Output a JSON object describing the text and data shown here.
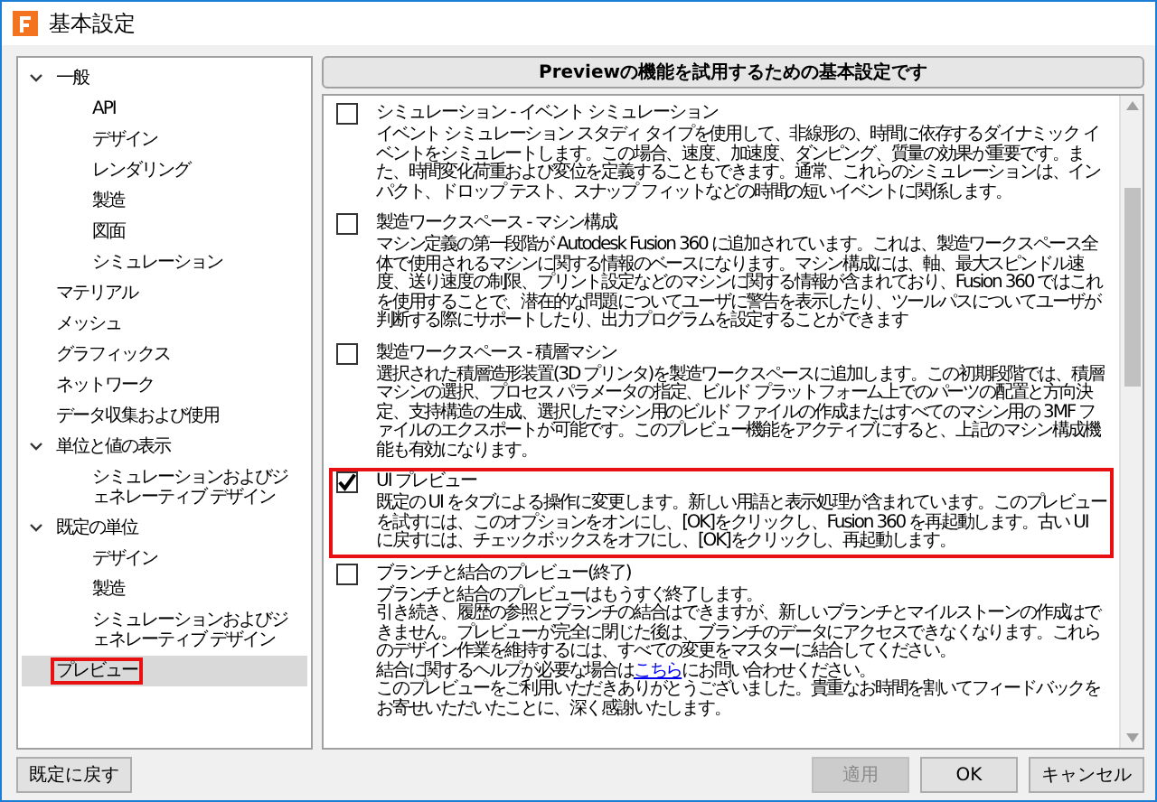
{
  "window": {
    "title": "基本設定"
  },
  "tree": [
    {
      "label": "一般",
      "expanded": true,
      "selected": false,
      "highlighted": false,
      "children": [
        {
          "label": "API",
          "selected": false,
          "highlighted": false
        },
        {
          "label": "デザイン",
          "selected": false,
          "highlighted": false
        },
        {
          "label": "レンダリング",
          "selected": false,
          "highlighted": false
        },
        {
          "label": "製造",
          "selected": false,
          "highlighted": false
        },
        {
          "label": "図面",
          "selected": false,
          "highlighted": false
        },
        {
          "label": "シミュレーション",
          "selected": false,
          "highlighted": false
        }
      ]
    },
    {
      "label": "マテリアル",
      "selected": false,
      "highlighted": false
    },
    {
      "label": "メッシュ",
      "selected": false,
      "highlighted": false
    },
    {
      "label": "グラフィックス",
      "selected": false,
      "highlighted": false
    },
    {
      "label": "ネットワーク",
      "selected": false,
      "highlighted": false
    },
    {
      "label": "データ収集および使用",
      "selected": false,
      "highlighted": false
    },
    {
      "label": "単位と値の表示",
      "expanded": true,
      "selected": false,
      "highlighted": false,
      "children": [
        {
          "label": "シミュレーションおよびジェネレーティブ デザイン",
          "selected": false,
          "highlighted": false
        }
      ]
    },
    {
      "label": "既定の単位",
      "expanded": true,
      "selected": false,
      "highlighted": false,
      "children": [
        {
          "label": "デザイン",
          "selected": false,
          "highlighted": false
        },
        {
          "label": "製造",
          "selected": false,
          "highlighted": false
        },
        {
          "label": "シミュレーションおよびジェネレーティブ デザイン",
          "selected": false,
          "highlighted": false
        }
      ]
    },
    {
      "label": "プレビュー",
      "selected": true,
      "highlighted": true
    }
  ],
  "reset_button": "既定に戻す",
  "header": "Previewの機能を試用するための基本設定です",
  "features": [
    {
      "title": "シミュレーション - イベント シミュレーション",
      "checked": false,
      "highlighted": false,
      "lines": [
        [
          {
            "text": "イベント シミュレーション スタディ タイプを使用して、非線形の、時間に依存するダイナミック イベントをシミュレートします。この場合、速度、加速度、ダンピング、質量の効果が重要です。また、時間変化荷重および変位を定義することもできます。通常、これらのシミュレーションは、インパクト、ドロップ テスト、スナップ フィットなどの時間の短いイベントに関係します。"
          }
        ]
      ]
    },
    {
      "title": "製造ワークスペース - マシン構成",
      "checked": false,
      "highlighted": false,
      "lines": [
        [
          {
            "text": "マシン定義の第一段階が Autodesk Fusion 360 に追加されています。これは、製造ワークスペース全体で使用されるマシンに関する情報のベースになります。マシン構成には、軸、最大スピンドル速度、送り速度の制限、プリント設定などのマシンに関する情報が含まれており、Fusion 360 ではこれを使用することで、潜在的な問題についてユーザに警告を表示したり、ツールパスについてユーザが判断する際にサポートしたり、出力プログラムを設定することができます"
          }
        ]
      ]
    },
    {
      "title": "製造ワークスペース - 積層マシン",
      "checked": false,
      "highlighted": false,
      "lines": [
        [
          {
            "text": "選択された積層造形装置(3D プリンタ)を製造ワークスペースに追加します。この初期段階では、積層マシンの選択、プロセス パラメータの指定、ビルド プラットフォーム上でのパーツの配置と方向決定、支持構造の生成、選択したマシン用のビルド ファイルの作成またはすべてのマシン用の 3MF ファイルのエクスポートが可能です。このプレビュー機能をアクティブにすると、上記のマシン構成機能も有効になります。"
          }
        ]
      ]
    },
    {
      "title": "UI プレビュー",
      "checked": true,
      "highlighted": true,
      "lines": [
        [
          {
            "text": "既定の UI をタブによる操作に変更します。新しい用語と表示処理が含まれています。このプレビューを試すには、このオプションをオンにし、[OK]をクリックし、Fusion 360 を再起動します。古い UI に戻すには、チェックボックスをオフにし、[OK]をクリックし、再起動します。"
          }
        ]
      ]
    },
    {
      "title": "ブランチと結合のプレビュー(終了)",
      "checked": false,
      "highlighted": false,
      "lines": [
        [
          {
            "text": "ブランチと結合のプレビューはもうすぐ終了します。"
          }
        ],
        [
          {
            "text": "引き続き、履歴の参照とブランチの結合はできますが、新しいブランチとマイルストーンの作成はできません。プレビューが完全に閉じた後は、ブランチのデータにアクセスできなくなります。これらのデザイン作業を維持するには、すべての変更をマスターに結合してください。"
          }
        ],
        [
          {
            "text": "結合に関するヘルプが必要な場合は"
          },
          {
            "link": "こちら"
          },
          {
            "text": "にお問い合わせください。"
          }
        ],
        [
          {
            "text": "このプレビューをご利用いただきありがとうございました。貴重なお時間を割いてフィードバックをお寄せいただいたことに、深く感謝いたします。"
          }
        ]
      ]
    }
  ],
  "buttons": [
    {
      "label": "適用",
      "disabled": true
    },
    {
      "label": "OK",
      "disabled": false
    },
    {
      "label": "キャンセル",
      "disabled": false
    }
  ]
}
